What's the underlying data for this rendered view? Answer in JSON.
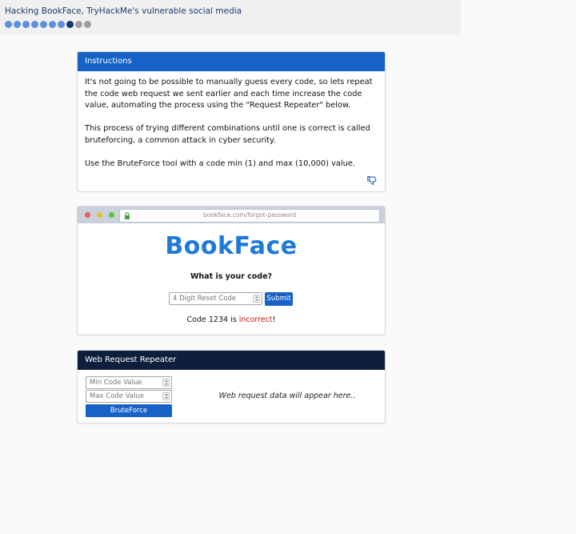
{
  "header": {
    "title": "Hacking BookFace, TryHackMe's vulnerable social media",
    "progress_dots": [
      "done",
      "done",
      "done",
      "done",
      "done",
      "done",
      "done",
      "current",
      "todo",
      "todo"
    ]
  },
  "instructions": {
    "heading": "Instructions",
    "paragraphs": [
      "It's not going to be possible to manually guess every code, so lets repeat the code web request we sent earlier and each time increase the code value, automating the process using the \"Request Repeater\" below.",
      "This process of trying different combinations until one is correct is called bruteforcing, a common attack in cyber security.",
      "Use the BruteForce tool with a code min (1) and max (10,000) value."
    ],
    "hint_icon": "thumbs-down-icon"
  },
  "browser": {
    "url": "bookface.com/forgot-password",
    "logo": "BookFace",
    "question": "What is your code?",
    "code_placeholder": "4 Digit Reset Code",
    "submit_label": "Submit",
    "result_prefix": "Code 1234 is ",
    "result_status": "incorrect",
    "result_suffix": "!"
  },
  "repeater": {
    "heading": "Web Request Repeater",
    "min_placeholder": "Min Code Value",
    "max_placeholder": "Max Code Value",
    "button_label": "BruteForce",
    "response_placeholder": "Web request data will appear here.."
  },
  "colors": {
    "primary": "#1762c6",
    "navy": "#0e1f3d",
    "logo": "#1f79d8",
    "error": "#d11515"
  }
}
